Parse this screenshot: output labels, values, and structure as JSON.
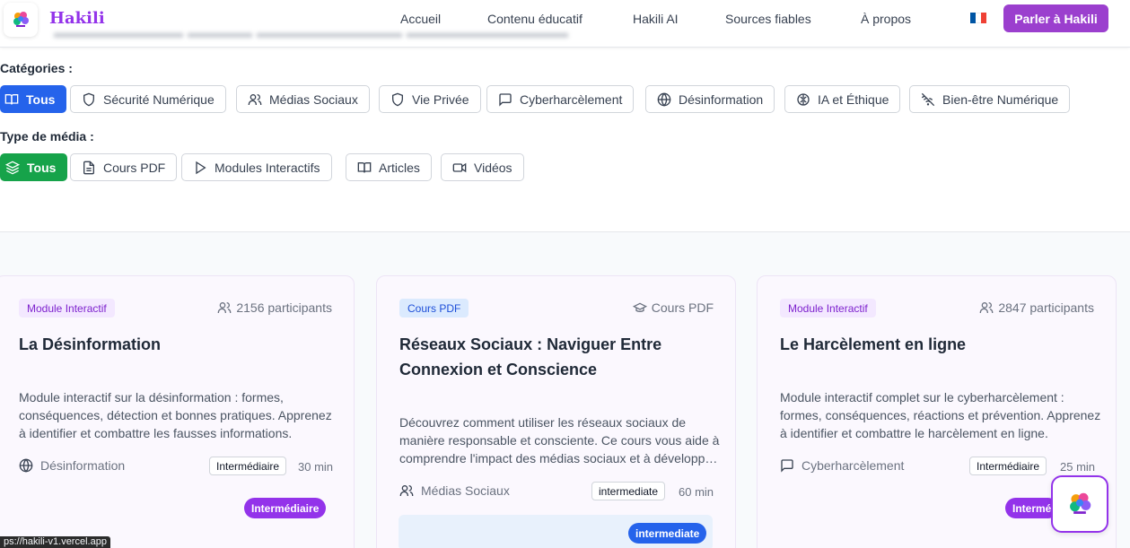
{
  "header": {
    "brand": "Hakili",
    "nav": [
      "Accueil",
      "Contenu éducatif",
      "Hakili AI",
      "Sources fiables",
      "À propos"
    ],
    "cta_label": "Parler à Hakili"
  },
  "filters": {
    "categories_label": "Catégories :",
    "categories": [
      {
        "label": "Tous",
        "icon": "book-open-icon",
        "active": true
      },
      {
        "label": "Sécurité Numérique",
        "icon": "shield-icon",
        "active": false
      },
      {
        "label": "Médias Sociaux",
        "icon": "users-icon",
        "active": false
      },
      {
        "label": "Vie Privée",
        "icon": "shield-icon",
        "active": false
      },
      {
        "label": "Cyberharcèlement",
        "icon": "message-square-icon",
        "active": false
      },
      {
        "label": "Désinformation",
        "icon": "globe-icon",
        "active": false
      },
      {
        "label": "IA et Éthique",
        "icon": "brain-icon",
        "active": false
      },
      {
        "label": "Bien-être Numérique",
        "icon": "wifi-off-icon",
        "active": false
      }
    ],
    "media_label": "Type de média :",
    "media_types": [
      {
        "label": "Tous",
        "icon": "layers-icon",
        "active": true
      },
      {
        "label": "Cours PDF",
        "icon": "file-text-icon",
        "active": false
      },
      {
        "label": "Modules Interactifs",
        "icon": "play-icon",
        "active": false
      },
      {
        "label": "Articles",
        "icon": "book-open-icon",
        "active": false
      },
      {
        "label": "Vidéos",
        "icon": "video-icon",
        "active": false
      }
    ]
  },
  "cards": [
    {
      "badge": "Module Interactif",
      "meta": "2156 participants",
      "meta_icon": "users-icon",
      "title": "La Désinformation",
      "description": "Module interactif sur la désinformation : formes, conséquences, détection et bonnes pratiques. Apprenez à identifier et combattre les fausses informations.",
      "category": "Désinformation",
      "category_icon": "globe-icon",
      "level": "Intermédiaire",
      "duration": "30 min",
      "level_pill": "Intermédiaire"
    },
    {
      "badge": "Cours PDF",
      "meta": "Cours PDF",
      "meta_icon": "graduation-cap-icon",
      "title": "Réseaux Sociaux : Naviguer Entre Connexion et Conscience",
      "description": "Découvrez comment utiliser les réseaux sociaux de manière responsable et consciente. Ce cours vous aide à comprendre l'impact des médias sociaux et à développer une utilisation saine.",
      "category": "Médias Sociaux",
      "category_icon": "users-icon",
      "level": "intermediate",
      "duration": "60 min",
      "level_pill": "intermediate"
    },
    {
      "badge": "Module Interactif",
      "meta": "2847 participants",
      "meta_icon": "users-icon",
      "title": "Le Harcèlement en ligne",
      "description": "Module interactif complet sur le cyberharcèlement : formes, conséquences, réactions et prévention. Apprenez à identifier et combattre le harcèlement en ligne.",
      "category": "Cyberharcèlement",
      "category_icon": "message-square-icon",
      "level": "Intermédiaire",
      "duration": "25 min",
      "level_pill": "Intermé"
    }
  ],
  "status_url": "ps://hakili-v1.vercel.app",
  "colors": {
    "brand_purple": "#9333ea",
    "active_blue": "#2563eb",
    "active_green": "#16a34a",
    "flag": [
      "#0055a4",
      "#ffffff",
      "#ef4135"
    ]
  }
}
